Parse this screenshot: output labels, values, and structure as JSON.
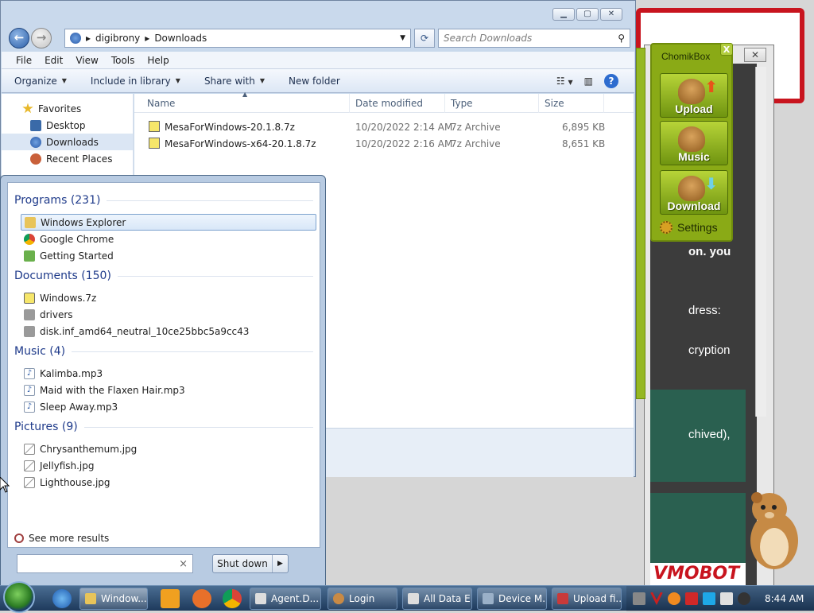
{
  "explorer": {
    "breadcrumb": [
      "digibrony",
      "Downloads"
    ],
    "search_placeholder": "Search Downloads",
    "menu": [
      "File",
      "Edit",
      "View",
      "Tools",
      "Help"
    ],
    "commands": [
      "Organize",
      "Include in library",
      "Share with",
      "New folder"
    ],
    "nav": {
      "favorites_label": "Favorites",
      "items": [
        "Desktop",
        "Downloads",
        "Recent Places"
      ]
    },
    "columns": [
      "Name",
      "Date modified",
      "Type",
      "Size"
    ],
    "files": [
      {
        "name": "MesaForWindows-20.1.8.7z",
        "date": "10/20/2022 2:14 AM",
        "type": "7z Archive",
        "size": "6,895 KB"
      },
      {
        "name": "MesaForWindows-x64-20.1.8.7z",
        "date": "10/20/2022 2:16 AM",
        "type": "7z Archive",
        "size": "8,651 KB"
      }
    ]
  },
  "chomikbox": {
    "title": "ChomikBox",
    "close": "X",
    "buttons": [
      "Upload",
      "Music",
      "Download"
    ],
    "settings": "Settings"
  },
  "background": {
    "lines": [
      "on. you",
      "dress:",
      "cryption",
      "chived),"
    ],
    "bottom_text": "VMOBOT"
  },
  "start_menu": {
    "sections": [
      {
        "title": "Programs (231)",
        "items": [
          "Windows Explorer",
          "Google Chrome",
          "Getting Started"
        ]
      },
      {
        "title": "Documents (150)",
        "items": [
          "Windows.7z",
          "drivers",
          "disk.inf_amd64_neutral_10ce25bbc5a9cc43"
        ]
      },
      {
        "title": "Music (4)",
        "items": [
          "Kalimba.mp3",
          "Maid with the Flaxen Hair.mp3",
          "Sleep Away.mp3"
        ]
      },
      {
        "title": "Pictures (9)",
        "items": [
          "Chrysanthemum.jpg",
          "Jellyfish.jpg",
          "Lighthouse.jpg"
        ]
      }
    ],
    "see_more": "See more results",
    "search_clear": "×",
    "shutdown": "Shut down"
  },
  "taskbar": {
    "tasks": [
      "Window...",
      "Agent.D...",
      "Login",
      "All Data E...",
      "Device M...",
      "Upload fi..."
    ],
    "clock": "8:44 AM"
  },
  "colors": {
    "selection": "#dbe6f4",
    "chomik_green": "#8aaa16",
    "taskbar": "#1e3a5c"
  }
}
